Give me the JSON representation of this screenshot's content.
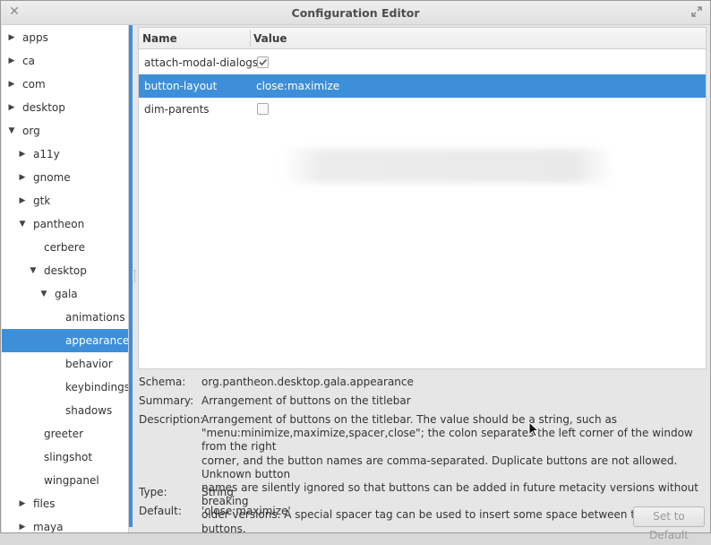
{
  "window": {
    "title": "Configuration Editor"
  },
  "tree": [
    {
      "label": "apps",
      "depth": 0,
      "arrow": "right"
    },
    {
      "label": "ca",
      "depth": 0,
      "arrow": "right"
    },
    {
      "label": "com",
      "depth": 0,
      "arrow": "right"
    },
    {
      "label": "desktop",
      "depth": 0,
      "arrow": "right"
    },
    {
      "label": "org",
      "depth": 0,
      "arrow": "down"
    },
    {
      "label": "a11y",
      "depth": 1,
      "arrow": "right"
    },
    {
      "label": "gnome",
      "depth": 1,
      "arrow": "right"
    },
    {
      "label": "gtk",
      "depth": 1,
      "arrow": "right"
    },
    {
      "label": "pantheon",
      "depth": 1,
      "arrow": "down"
    },
    {
      "label": "cerbere",
      "depth": 2,
      "arrow": ""
    },
    {
      "label": "desktop",
      "depth": 2,
      "arrow": "down"
    },
    {
      "label": "gala",
      "depth": 3,
      "arrow": "down"
    },
    {
      "label": "animations",
      "depth": 4,
      "arrow": ""
    },
    {
      "label": "appearance",
      "depth": 4,
      "arrow": "",
      "selected": true
    },
    {
      "label": "behavior",
      "depth": 4,
      "arrow": ""
    },
    {
      "label": "keybindings",
      "depth": 4,
      "arrow": ""
    },
    {
      "label": "shadows",
      "depth": 4,
      "arrow": ""
    },
    {
      "label": "greeter",
      "depth": 2,
      "arrow": ""
    },
    {
      "label": "slingshot",
      "depth": 2,
      "arrow": ""
    },
    {
      "label": "wingpanel",
      "depth": 2,
      "arrow": ""
    },
    {
      "label": "files",
      "depth": 1,
      "arrow": "right"
    },
    {
      "label": "maya",
      "depth": 1,
      "arrow": "right"
    }
  ],
  "table": {
    "headers": {
      "name": "Name",
      "value": "Value"
    },
    "rows": [
      {
        "name": "attach-modal-dialogs",
        "type": "checkbox",
        "checked": true
      },
      {
        "name": "button-layout",
        "type": "text",
        "value": "close:maximize",
        "selected": true
      },
      {
        "name": "dim-parents",
        "type": "checkbox",
        "checked": false
      }
    ]
  },
  "info": {
    "schema_label": "Schema:",
    "schema": "org.pantheon.desktop.gala.appearance",
    "summary_label": "Summary:",
    "summary": "Arrangement of buttons on the titlebar",
    "description_label": "Description:",
    "description_lines": [
      "Arrangement of buttons on the titlebar. The value should be a string, such as",
      "\"menu:minimize,maximize,spacer,close\"; the colon separates the left corner of the window from the right",
      "corner, and the button names are comma-separated. Duplicate buttons are not allowed. Unknown button",
      "names are silently ignored so that buttons can be added in future metacity versions without breaking",
      "older versions. A special spacer tag can be used to insert some space between two adjacent buttons."
    ],
    "type_label": "Type:",
    "type": "String",
    "default_label": "Default:",
    "default": "'close:maximize'"
  },
  "buttons": {
    "set_default": "Set to Default"
  },
  "colors": {
    "accent": "#3d8fd9"
  },
  "icons": {
    "close": "close-icon",
    "maximize": "maximize-icon",
    "expander": "triangle-icon",
    "checkmark": "checkmark-icon"
  }
}
